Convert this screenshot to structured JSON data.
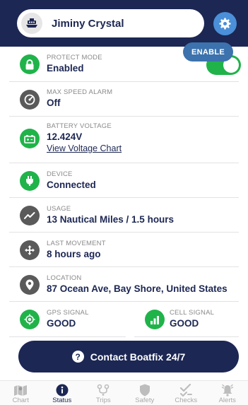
{
  "header": {
    "boat_name": "Jiminy Crystal"
  },
  "rows": {
    "protect": {
      "label": "PROTECT MODE",
      "value": "Enabled",
      "toggle_on": true
    },
    "speed": {
      "label": "MAX SPEED ALARM",
      "value": "Off",
      "button": "ENABLE"
    },
    "battery": {
      "label": "BATTERY VOLTAGE",
      "value": "12.424V",
      "link": "View Voltage Chart"
    },
    "device": {
      "label": "DEVICE",
      "value": "Connected"
    },
    "usage": {
      "label": "USAGE",
      "value": "13 Nautical Miles / 1.5 hours"
    },
    "movement": {
      "label": "LAST MOVEMENT",
      "value": "8 hours ago"
    },
    "location": {
      "label": "LOCATION",
      "value": "87 Ocean Ave, Bay Shore, United States"
    },
    "gps": {
      "label": "GPS SIGNAL",
      "value": "GOOD"
    },
    "cell": {
      "label": "CELL SIGNAL",
      "value": "GOOD"
    }
  },
  "contact": {
    "label": "Contact Boatfix 24/7"
  },
  "tabs": [
    {
      "label": "Chart",
      "icon": "map-icon"
    },
    {
      "label": "Status",
      "icon": "info-icon",
      "active": true
    },
    {
      "label": "Trips",
      "icon": "route-icon"
    },
    {
      "label": "Safety",
      "icon": "shield-icon"
    },
    {
      "label": "Checks",
      "icon": "checklist-icon"
    },
    {
      "label": "Alerts",
      "icon": "bell-icon"
    }
  ],
  "colors": {
    "navy": "#1c2753",
    "green": "#20b34a",
    "gray_icon": "#5a5a5a",
    "blue": "#3c72ad",
    "settings": "#4a8fd8"
  }
}
